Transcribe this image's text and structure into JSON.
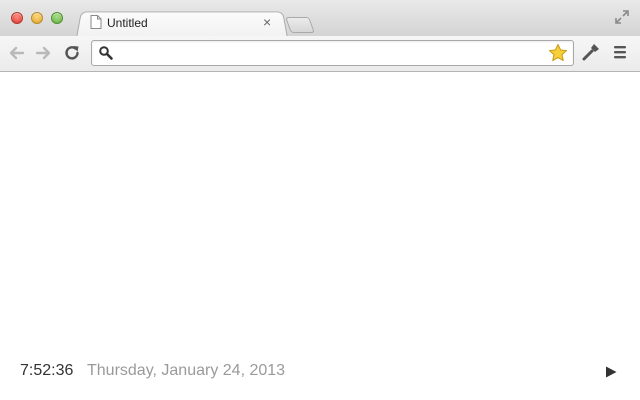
{
  "window": {
    "traffic_lights": [
      "close",
      "minimize",
      "zoom"
    ]
  },
  "tabs": [
    {
      "title": "Untitled",
      "icon": "page-icon",
      "active": true
    }
  ],
  "tab_close_glyph": "×",
  "toolbar": {
    "back_icon": "back-arrow-icon",
    "forward_icon": "forward-arrow-icon",
    "reload_icon": "reload-icon",
    "omnibox": {
      "value": "",
      "placeholder": "",
      "icon": "search-icon"
    },
    "bookmark_icon": "star-icon",
    "bookmark_color": "#f5c518",
    "wrench_icon": "wrench-icon",
    "menu_icon": "menu-icon"
  },
  "page": {
    "time": "7:52:36",
    "date": "Thursday, January 24, 2013",
    "play_icon": "play-icon"
  }
}
